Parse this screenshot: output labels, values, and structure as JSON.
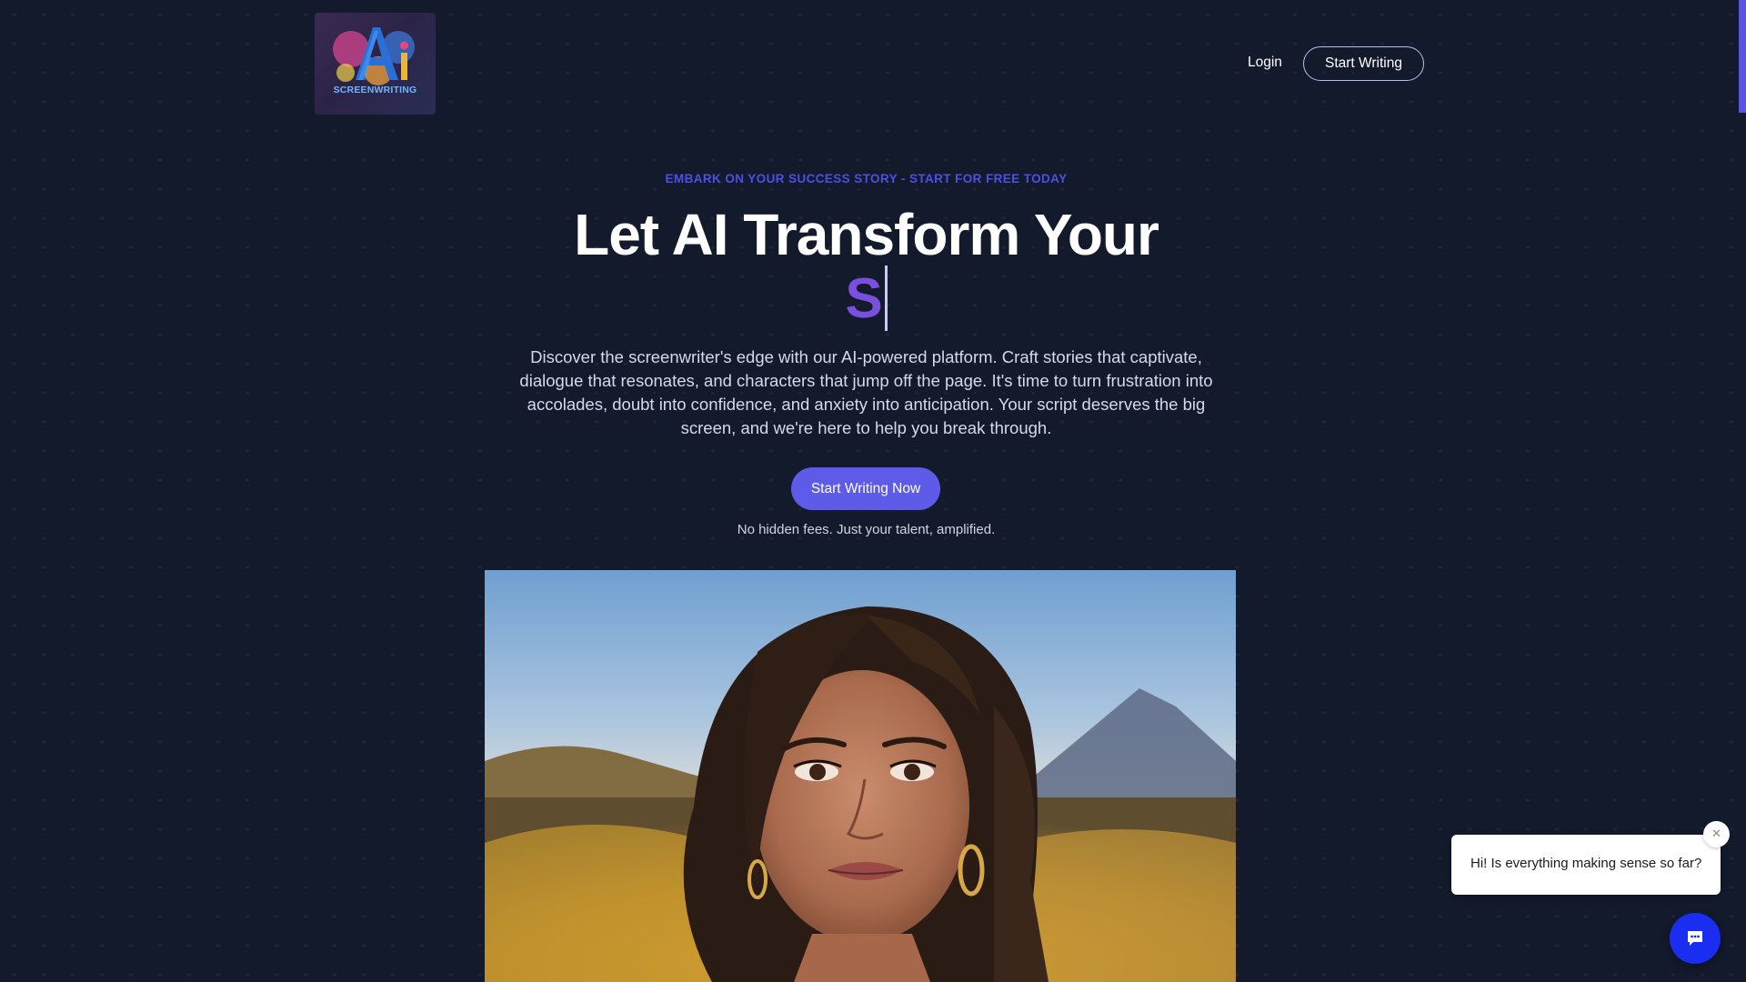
{
  "logo": {
    "text": "SCREENWRITING",
    "icon": "ai-screenwriting-logo"
  },
  "nav": {
    "login_label": "Login",
    "start_label": "Start Writing"
  },
  "hero": {
    "eyebrow": "EMBARK ON YOUR SUCCESS STORY - START FOR FREE TODAY",
    "headline": "Let AI Transform Your",
    "typed_text": "S",
    "description": "Discover the screenwriter's edge with our AI-powered platform. Craft stories that captivate, dialogue that resonates, and characters that jump off the page. It's time to turn frustration into accolades, doubt into confidence, and anxiety into anticipation. Your script deserves the big screen, and we're here to help you break through.",
    "cta_label": "Start Writing Now",
    "subnote": "No hidden fees. Just your talent, amplified."
  },
  "chat": {
    "message": "Hi! Is everything making sense so far?",
    "close_icon": "close-icon",
    "launcher_icon": "chat-icon"
  },
  "colors": {
    "background": "#131a2c",
    "accent": "#5d5be7",
    "eyebrow": "#4e4fe0",
    "typed": "#7a4fe0",
    "chat_launcher": "#1a2ef2"
  }
}
